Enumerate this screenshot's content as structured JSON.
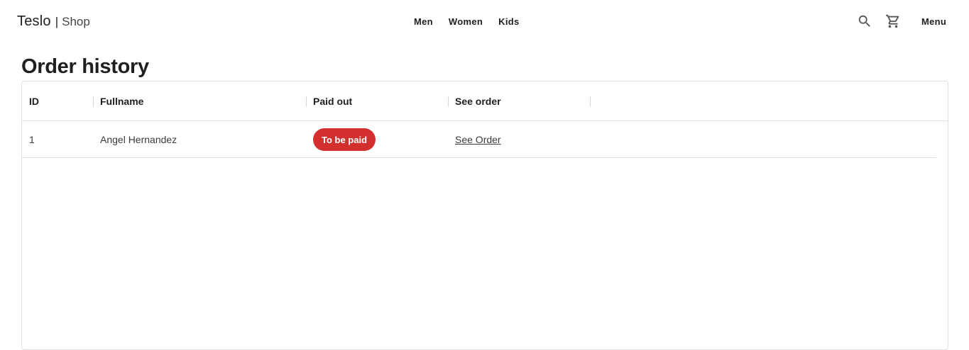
{
  "brand": {
    "name": "Teslo",
    "separator": "|",
    "sub": "Shop"
  },
  "nav": {
    "links": [
      "Men",
      "Women",
      "Kids"
    ],
    "menu_label": "Menu"
  },
  "icons": {
    "search": "search-icon",
    "cart": "cart-icon"
  },
  "page": {
    "title": "Order history"
  },
  "table": {
    "columns": [
      "ID",
      "Fullname",
      "Paid out",
      "See order"
    ],
    "rows": [
      {
        "id": "1",
        "fullname": "Angel Hernandez",
        "paid_status": "To be paid",
        "link": "See Order"
      }
    ]
  },
  "colors": {
    "unpaid_chip": "#d32f2f"
  }
}
